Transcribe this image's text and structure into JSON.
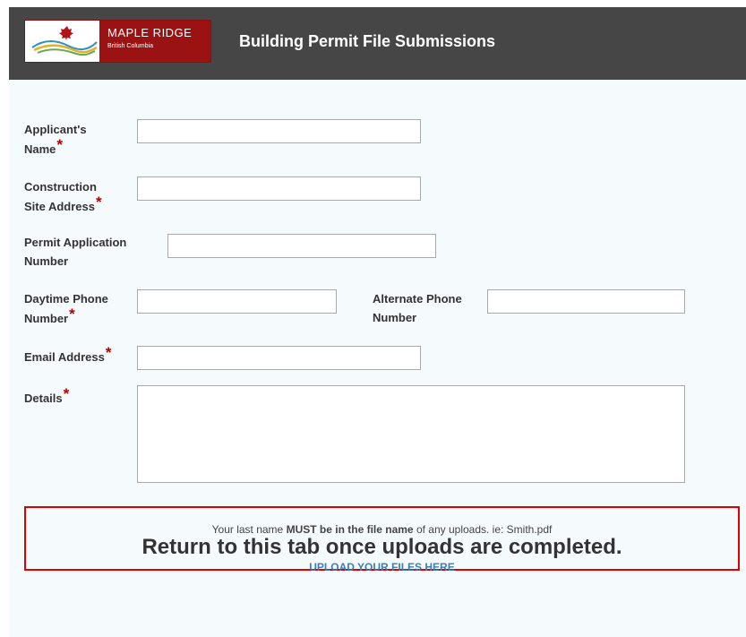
{
  "header": {
    "logo_name": "MAPLE RIDGE",
    "logo_sub": "British Columbia",
    "title": "Building Permit File Submissions"
  },
  "form": {
    "applicant_name_label_1": "Applicant's",
    "applicant_name_label_2": "Name",
    "site_address_label_1": "Construction",
    "site_address_label_2": "Site Address",
    "permit_number_label_1": "Permit Application",
    "permit_number_label_2": "Number",
    "daytime_phone_label_1": "Daytime Phone",
    "daytime_phone_label_2": "Number",
    "alternate_phone_label_1": "Alternate Phone",
    "alternate_phone_label_2": "Number",
    "email_label": "Email Address",
    "details_label": "Details",
    "required_marker": "*",
    "applicant_name_value": "",
    "site_address_value": "",
    "permit_number_value": "",
    "daytime_phone_value": "",
    "alternate_phone_value": "",
    "email_value": "",
    "details_value": ""
  },
  "notice": {
    "text_pre": "Your last name ",
    "text_bold": "MUST be in the file name",
    "text_post": " of any uploads. ie:  Smith.pdf",
    "headline": "Return to this tab once uploads are completed.",
    "link_label": "UPLOAD YOUR FILES HERE"
  },
  "colors": {
    "header_bg": "#464646",
    "logo_red": "#9b1212",
    "required": "#b00000",
    "notice_border": "#e00000",
    "link": "#3d7eb6",
    "form_bg": "#f5fafd"
  }
}
